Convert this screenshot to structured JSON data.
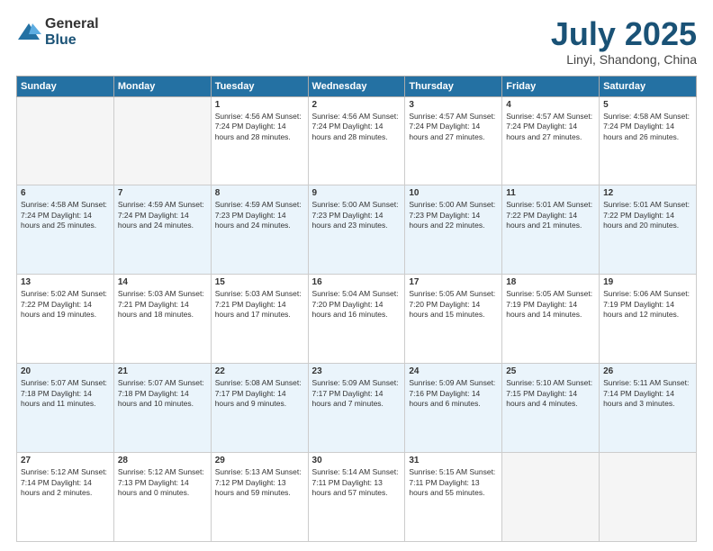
{
  "header": {
    "logo_general": "General",
    "logo_blue": "Blue",
    "month_title": "July 2025",
    "location": "Linyi, Shandong, China"
  },
  "weekdays": [
    "Sunday",
    "Monday",
    "Tuesday",
    "Wednesday",
    "Thursday",
    "Friday",
    "Saturday"
  ],
  "weeks": [
    [
      {
        "day": "",
        "info": ""
      },
      {
        "day": "",
        "info": ""
      },
      {
        "day": "1",
        "info": "Sunrise: 4:56 AM\nSunset: 7:24 PM\nDaylight: 14 hours and 28 minutes."
      },
      {
        "day": "2",
        "info": "Sunrise: 4:56 AM\nSunset: 7:24 PM\nDaylight: 14 hours and 28 minutes."
      },
      {
        "day": "3",
        "info": "Sunrise: 4:57 AM\nSunset: 7:24 PM\nDaylight: 14 hours and 27 minutes."
      },
      {
        "day": "4",
        "info": "Sunrise: 4:57 AM\nSunset: 7:24 PM\nDaylight: 14 hours and 27 minutes."
      },
      {
        "day": "5",
        "info": "Sunrise: 4:58 AM\nSunset: 7:24 PM\nDaylight: 14 hours and 26 minutes."
      }
    ],
    [
      {
        "day": "6",
        "info": "Sunrise: 4:58 AM\nSunset: 7:24 PM\nDaylight: 14 hours and 25 minutes."
      },
      {
        "day": "7",
        "info": "Sunrise: 4:59 AM\nSunset: 7:24 PM\nDaylight: 14 hours and 24 minutes."
      },
      {
        "day": "8",
        "info": "Sunrise: 4:59 AM\nSunset: 7:23 PM\nDaylight: 14 hours and 24 minutes."
      },
      {
        "day": "9",
        "info": "Sunrise: 5:00 AM\nSunset: 7:23 PM\nDaylight: 14 hours and 23 minutes."
      },
      {
        "day": "10",
        "info": "Sunrise: 5:00 AM\nSunset: 7:23 PM\nDaylight: 14 hours and 22 minutes."
      },
      {
        "day": "11",
        "info": "Sunrise: 5:01 AM\nSunset: 7:22 PM\nDaylight: 14 hours and 21 minutes."
      },
      {
        "day": "12",
        "info": "Sunrise: 5:01 AM\nSunset: 7:22 PM\nDaylight: 14 hours and 20 minutes."
      }
    ],
    [
      {
        "day": "13",
        "info": "Sunrise: 5:02 AM\nSunset: 7:22 PM\nDaylight: 14 hours and 19 minutes."
      },
      {
        "day": "14",
        "info": "Sunrise: 5:03 AM\nSunset: 7:21 PM\nDaylight: 14 hours and 18 minutes."
      },
      {
        "day": "15",
        "info": "Sunrise: 5:03 AM\nSunset: 7:21 PM\nDaylight: 14 hours and 17 minutes."
      },
      {
        "day": "16",
        "info": "Sunrise: 5:04 AM\nSunset: 7:20 PM\nDaylight: 14 hours and 16 minutes."
      },
      {
        "day": "17",
        "info": "Sunrise: 5:05 AM\nSunset: 7:20 PM\nDaylight: 14 hours and 15 minutes."
      },
      {
        "day": "18",
        "info": "Sunrise: 5:05 AM\nSunset: 7:19 PM\nDaylight: 14 hours and 14 minutes."
      },
      {
        "day": "19",
        "info": "Sunrise: 5:06 AM\nSunset: 7:19 PM\nDaylight: 14 hours and 12 minutes."
      }
    ],
    [
      {
        "day": "20",
        "info": "Sunrise: 5:07 AM\nSunset: 7:18 PM\nDaylight: 14 hours and 11 minutes."
      },
      {
        "day": "21",
        "info": "Sunrise: 5:07 AM\nSunset: 7:18 PM\nDaylight: 14 hours and 10 minutes."
      },
      {
        "day": "22",
        "info": "Sunrise: 5:08 AM\nSunset: 7:17 PM\nDaylight: 14 hours and 9 minutes."
      },
      {
        "day": "23",
        "info": "Sunrise: 5:09 AM\nSunset: 7:17 PM\nDaylight: 14 hours and 7 minutes."
      },
      {
        "day": "24",
        "info": "Sunrise: 5:09 AM\nSunset: 7:16 PM\nDaylight: 14 hours and 6 minutes."
      },
      {
        "day": "25",
        "info": "Sunrise: 5:10 AM\nSunset: 7:15 PM\nDaylight: 14 hours and 4 minutes."
      },
      {
        "day": "26",
        "info": "Sunrise: 5:11 AM\nSunset: 7:14 PM\nDaylight: 14 hours and 3 minutes."
      }
    ],
    [
      {
        "day": "27",
        "info": "Sunrise: 5:12 AM\nSunset: 7:14 PM\nDaylight: 14 hours and 2 minutes."
      },
      {
        "day": "28",
        "info": "Sunrise: 5:12 AM\nSunset: 7:13 PM\nDaylight: 14 hours and 0 minutes."
      },
      {
        "day": "29",
        "info": "Sunrise: 5:13 AM\nSunset: 7:12 PM\nDaylight: 13 hours and 59 minutes."
      },
      {
        "day": "30",
        "info": "Sunrise: 5:14 AM\nSunset: 7:11 PM\nDaylight: 13 hours and 57 minutes."
      },
      {
        "day": "31",
        "info": "Sunrise: 5:15 AM\nSunset: 7:11 PM\nDaylight: 13 hours and 55 minutes."
      },
      {
        "day": "",
        "info": ""
      },
      {
        "day": "",
        "info": ""
      }
    ]
  ]
}
